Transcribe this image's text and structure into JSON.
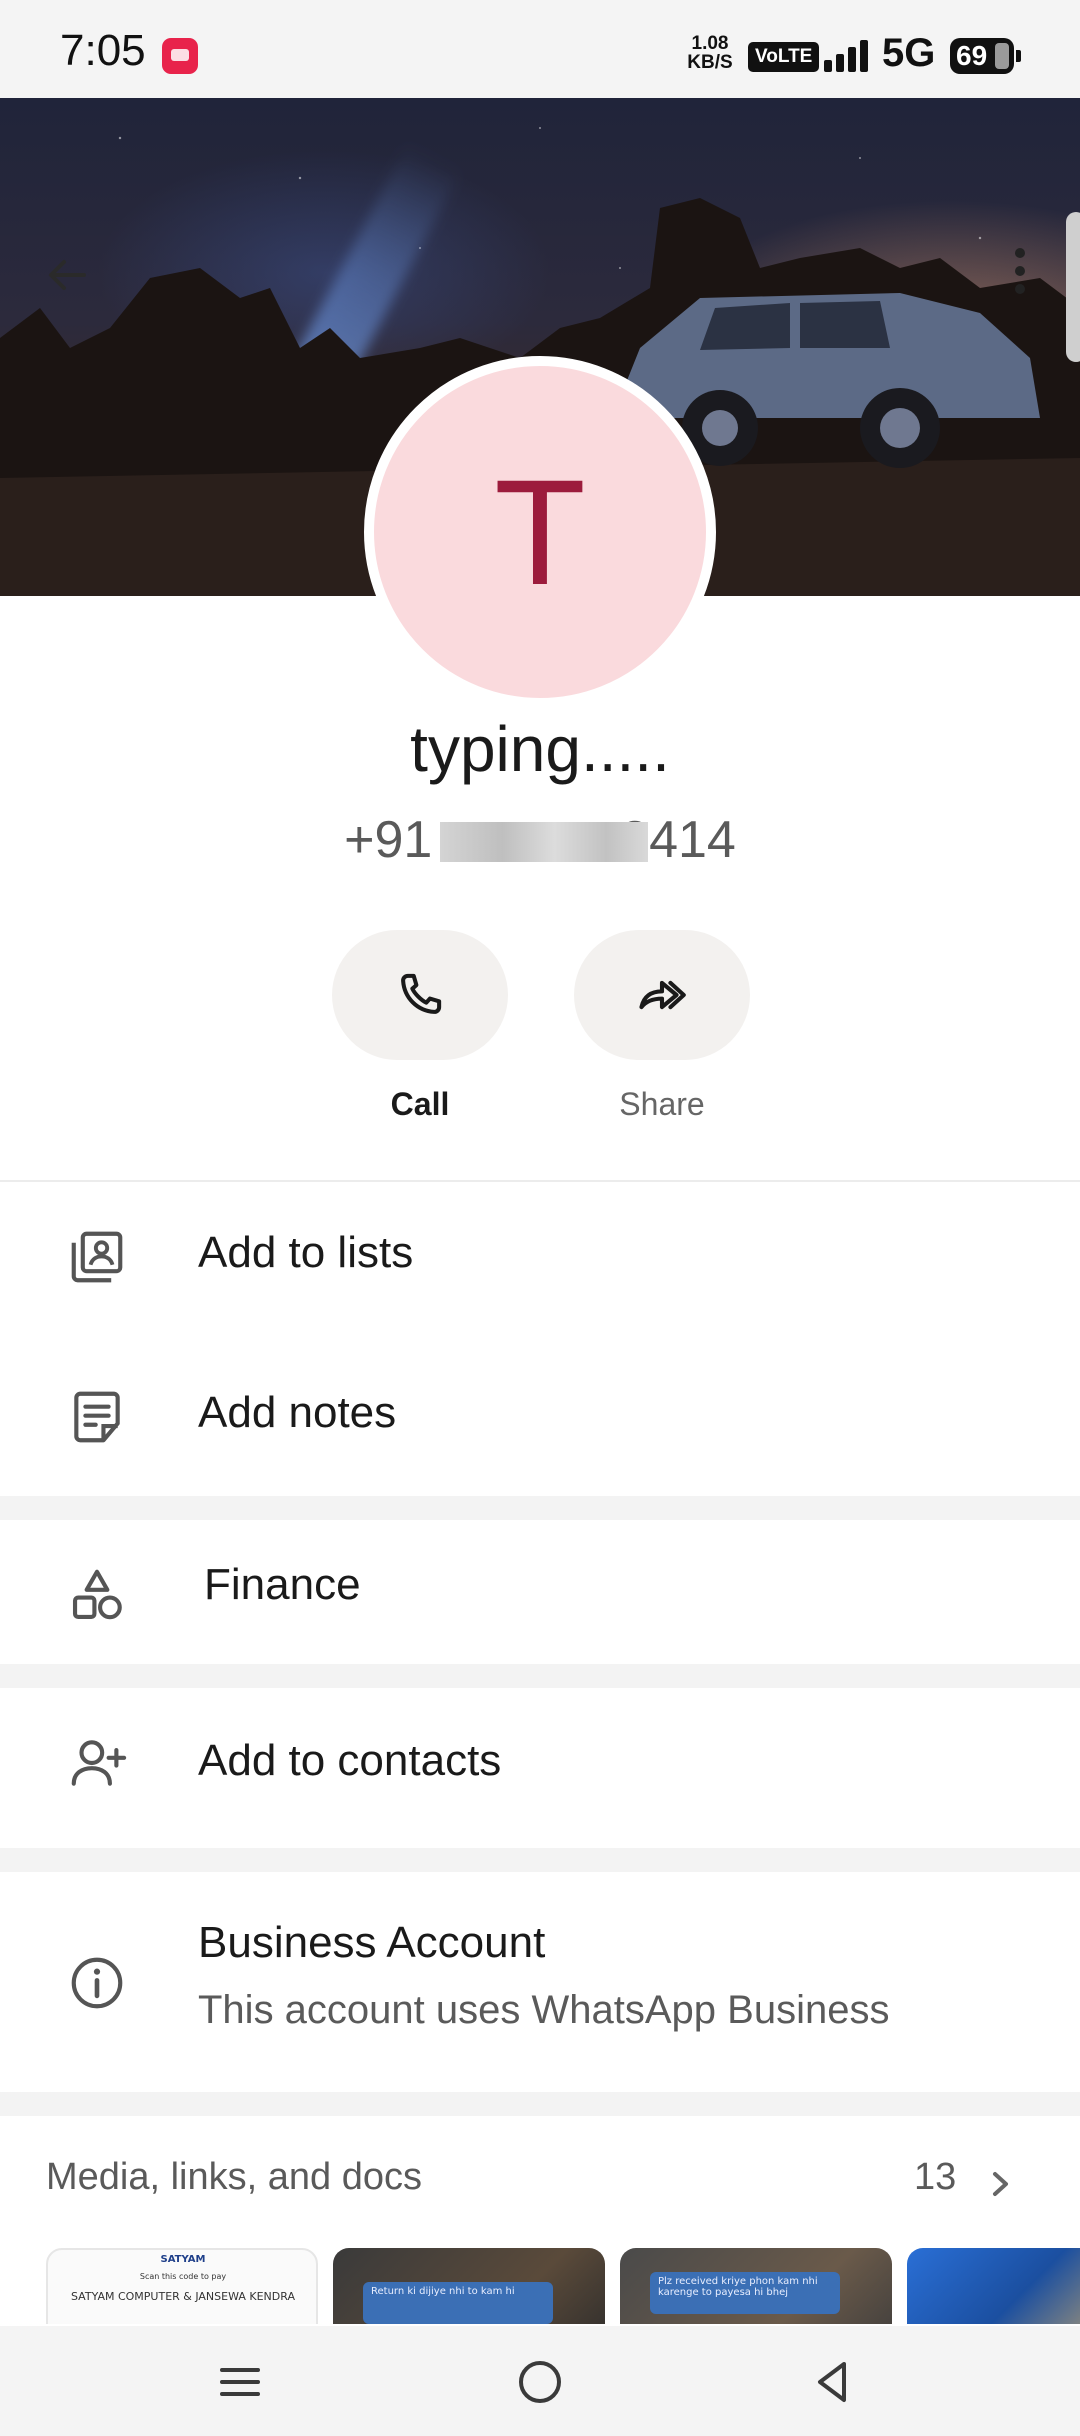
{
  "status_bar": {
    "time": "7:05",
    "app_icon_label": "snapdeal",
    "speed_value": "1.08",
    "speed_unit": "KB/S",
    "volte": "VoLTE",
    "network": "5G",
    "battery": "69"
  },
  "contact": {
    "avatar_letter": "T",
    "name": "typing.....",
    "phone": "+91             2414"
  },
  "actions": {
    "call_label": "Call",
    "share_label": "Share"
  },
  "rows": {
    "add_to_lists": "Add to lists",
    "add_notes": "Add notes",
    "finance": "Finance",
    "add_to_contacts": "Add to contacts"
  },
  "business": {
    "title": "Business Account",
    "subtitle": "This account uses WhatsApp Business"
  },
  "media": {
    "label": "Media, links, and docs",
    "count": "13",
    "thumb1_logo": "SATYAM",
    "thumb1_line1": "Scan this code to pay",
    "thumb1_line2": "SATYAM COMPUTER & JANSEWA KENDRA",
    "thumb2_text": "Return ki dijiye nhi to kam hi",
    "thumb3_text": "Plz received kriye phon kam nhi karenge to payesa hi bhej"
  },
  "colors": {
    "avatar_bg": "#fadadd",
    "avatar_letter": "#9c1b3c",
    "action_bg": "#f3f1ef",
    "status_bar_bg": "#f4f4f4"
  },
  "icons": {
    "back": "arrow-left-icon",
    "menu": "more-vertical-icon",
    "call": "phone-icon",
    "share": "share-forward-icon",
    "lists": "contact-list-icon",
    "notes": "note-icon",
    "finance": "shapes-icon",
    "contacts": "person-add-icon",
    "info": "info-icon",
    "chevron": "chevron-right-icon"
  }
}
